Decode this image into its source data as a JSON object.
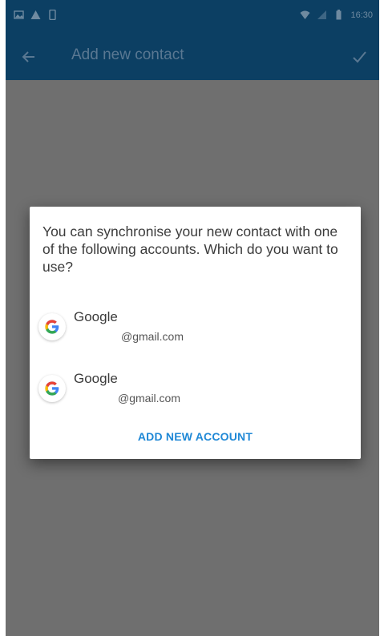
{
  "app_bar": {
    "title": "Add new contact",
    "back_icon": "arrow-left-icon",
    "confirm_icon": "check-icon"
  },
  "status_bar": {
    "time": "16:30",
    "left_icons": [
      "image-icon",
      "warning-icon",
      "phone-icon"
    ],
    "right_icons": [
      "wifi-icon",
      "signal-icon",
      "battery-icon"
    ]
  },
  "dialog": {
    "message": "You can synchronise your new contact with one of the following accounts. Which do you want to use?",
    "accounts": [
      {
        "provider": "Google",
        "email": "@gmail.com",
        "icon": "google-icon"
      },
      {
        "provider": "Google",
        "email": "@gmail.com",
        "icon": "google-icon"
      }
    ],
    "add_account_label": "ADD NEW ACCOUNT"
  },
  "colors": {
    "toolbar": "#0c3f63",
    "scrim": "#6f6f6f",
    "accent": "#1f88d6",
    "dialog_bg": "#ffffff"
  }
}
